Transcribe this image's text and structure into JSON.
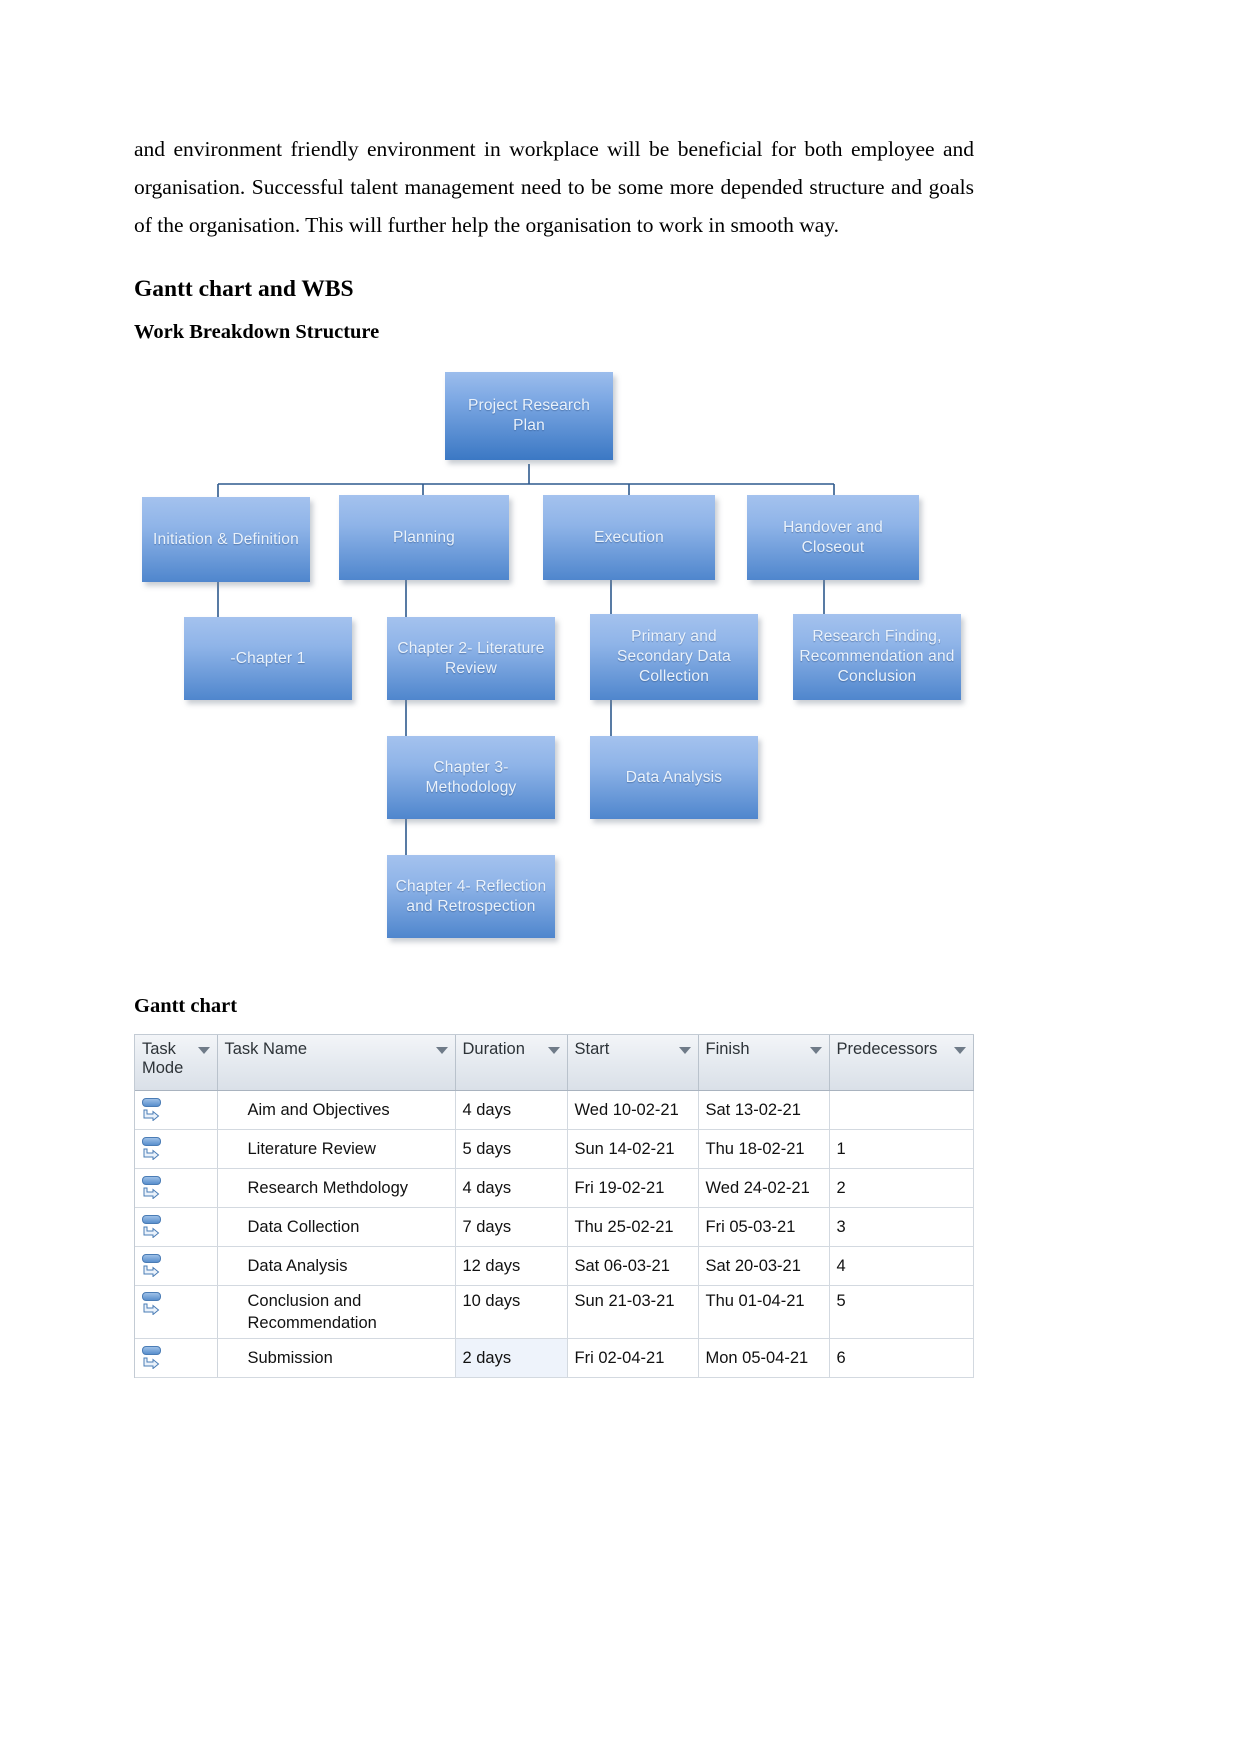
{
  "document": {
    "paragraph": "and environment friendly environment in workplace will be beneficial for both employee and organisation. Successful talent management need to be some more depended structure and goals of the organisation. This will further help the organisation to work in smooth way.",
    "heading_main": "Gantt chart and WBS",
    "heading_wbs": "Work Breakdown Structure",
    "heading_gantt": "Gantt chart"
  },
  "wbs": {
    "root": "Project Research Plan",
    "level2": [
      "Initiation & Definition",
      "Planning",
      "Execution",
      "Handover and Closeout"
    ],
    "level3": {
      "initiation": [
        "-Chapter 1"
      ],
      "planning": [
        "Chapter 2- Literature Review",
        "Chapter 3- Methodology",
        "Chapter 4- Reflection and Retrospection"
      ],
      "execution": [
        "Primary and Secondary Data Collection",
        "Data Analysis"
      ],
      "handover": [
        "Research Finding, Recommendation and Conclusion"
      ]
    },
    "colors": {
      "box_light": "#8fb4e8",
      "box_dark": "#3b78c4",
      "connector": "#2e5a8e",
      "text": "#eaf2fb"
    }
  },
  "gantt_table": {
    "columns": [
      "Task Mode",
      "Task Name",
      "Duration",
      "Start",
      "Finish",
      "Predecessors"
    ],
    "rows": [
      {
        "mode": "auto-scheduled-icon",
        "name": "Aim and Objectives",
        "duration": "4 days",
        "start": "Wed 10-02-21",
        "finish": "Sat 13-02-21",
        "predecessors": ""
      },
      {
        "mode": "auto-scheduled-icon",
        "name": "Literature Review",
        "duration": "5 days",
        "start": "Sun 14-02-21",
        "finish": "Thu 18-02-21",
        "predecessors": "1"
      },
      {
        "mode": "auto-scheduled-icon",
        "name": "Research Methdology",
        "duration": "4 days",
        "start": "Fri 19-02-21",
        "finish": "Wed 24-02-21",
        "predecessors": "2"
      },
      {
        "mode": "auto-scheduled-icon",
        "name": "Data Collection",
        "duration": "7 days",
        "start": "Thu 25-02-21",
        "finish": "Fri 05-03-21",
        "predecessors": "3"
      },
      {
        "mode": "auto-scheduled-icon",
        "name": "Data Analysis",
        "duration": "12 days",
        "start": "Sat 06-03-21",
        "finish": "Sat 20-03-21",
        "predecessors": "4"
      },
      {
        "mode": "auto-scheduled-icon",
        "name": "Conclusion and Recommendation",
        "duration": "10 days",
        "start": "Sun 21-03-21",
        "finish": "Thu 01-04-21",
        "predecessors": "5"
      },
      {
        "mode": "auto-scheduled-icon",
        "name": "Submission",
        "duration": "2 days",
        "start": "Fri 02-04-21",
        "finish": "Mon 05-04-21",
        "predecessors": "6"
      }
    ]
  },
  "chart_data": {
    "type": "table",
    "title": "Gantt chart",
    "columns": [
      "Task Mode",
      "Task Name",
      "Duration",
      "Start",
      "Finish",
      "Predecessors"
    ],
    "rows": [
      [
        "auto",
        "Aim and Objectives",
        "4 days",
        "Wed 10-02-21",
        "Sat 13-02-21",
        ""
      ],
      [
        "auto",
        "Literature Review",
        "5 days",
        "Sun 14-02-21",
        "Thu 18-02-21",
        "1"
      ],
      [
        "auto",
        "Research Methdology",
        "4 days",
        "Fri 19-02-21",
        "Wed 24-02-21",
        "2"
      ],
      [
        "auto",
        "Data Collection",
        "7 days",
        "Thu 25-02-21",
        "Fri 05-03-21",
        "3"
      ],
      [
        "auto",
        "Data Analysis",
        "12 days",
        "Sat 06-03-21",
        "Sat 20-03-21",
        "4"
      ],
      [
        "auto",
        "Conclusion and Recommendation",
        "10 days",
        "Sun 21-03-21",
        "Thu 01-04-21",
        "5"
      ],
      [
        "auto",
        "Submission",
        "2 days",
        "Fri 02-04-21",
        "Mon 05-04-21",
        "6"
      ]
    ]
  }
}
